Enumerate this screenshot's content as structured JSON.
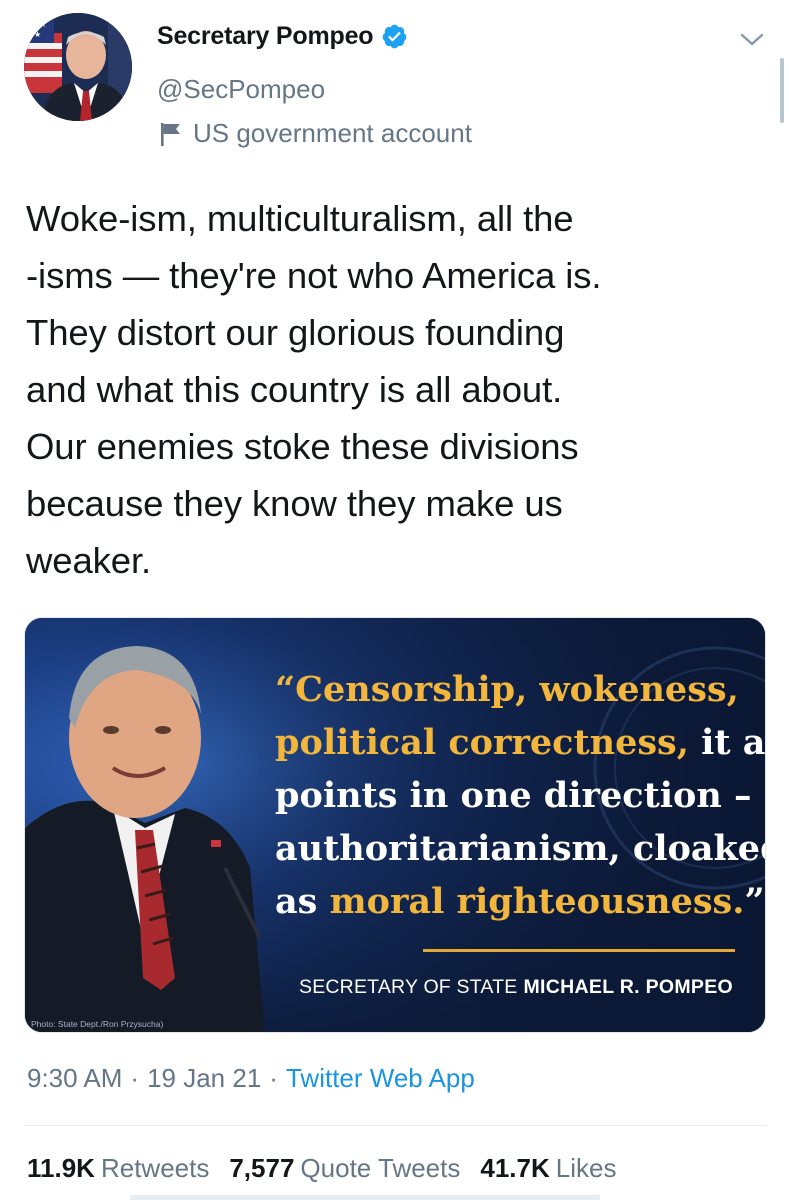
{
  "tweet": {
    "author": {
      "display_name": "Secretary Pompeo",
      "handle": "@SecPompeo",
      "verified": true,
      "account_label": "US government account"
    },
    "text": "Woke-ism, multiculturalism, all the\n-isms — they're not who America is.\nThey distort our glorious founding\nand what this country is all about.\nOur enemies stoke these divisions\nbecause they know they make us\nweaker.",
    "media": {
      "quote_lines": [
        [
          {
            "text": "“Censorship, wokeness,",
            "style": "gold"
          }
        ],
        [
          {
            "text": "political correctness, ",
            "style": "gold"
          },
          {
            "text": "it all",
            "style": "white"
          }
        ],
        [
          {
            "text": "points in one direction –",
            "style": "white"
          }
        ],
        [
          {
            "text": "authoritarianism, cloaked",
            "style": "white"
          }
        ],
        [
          {
            "text": "as ",
            "style": "white"
          },
          {
            "text": "moral righteousness.",
            "style": "gold"
          },
          {
            "text": "”",
            "style": "white"
          }
        ]
      ],
      "attribution_title": "SECRETARY OF STATE",
      "attribution_name": "MICHAEL R. POMPEO",
      "photo_credit": "Photo: State Dept./Ron Przysucha)"
    },
    "time": "9:30 AM",
    "separator": "·",
    "date": "19 Jan 21",
    "source": "Twitter Web App",
    "stats": {
      "retweets": {
        "count": "11.9K",
        "label": "Retweets"
      },
      "quote_tweets": {
        "count": "7,577",
        "label": "Quote Tweets"
      },
      "likes": {
        "count": "41.7K",
        "label": "Likes"
      }
    }
  },
  "colors": {
    "text_primary": "#14171a",
    "text_secondary": "#657786",
    "link_blue": "#1b95e0",
    "verified_blue": "#1da1f2",
    "quote_gold": "#f2b63c",
    "media_navy": "#0f1f3e"
  },
  "icons": {
    "verified": "verified-badge-icon",
    "flag": "flag-icon",
    "chevron": "chevron-down-icon"
  }
}
